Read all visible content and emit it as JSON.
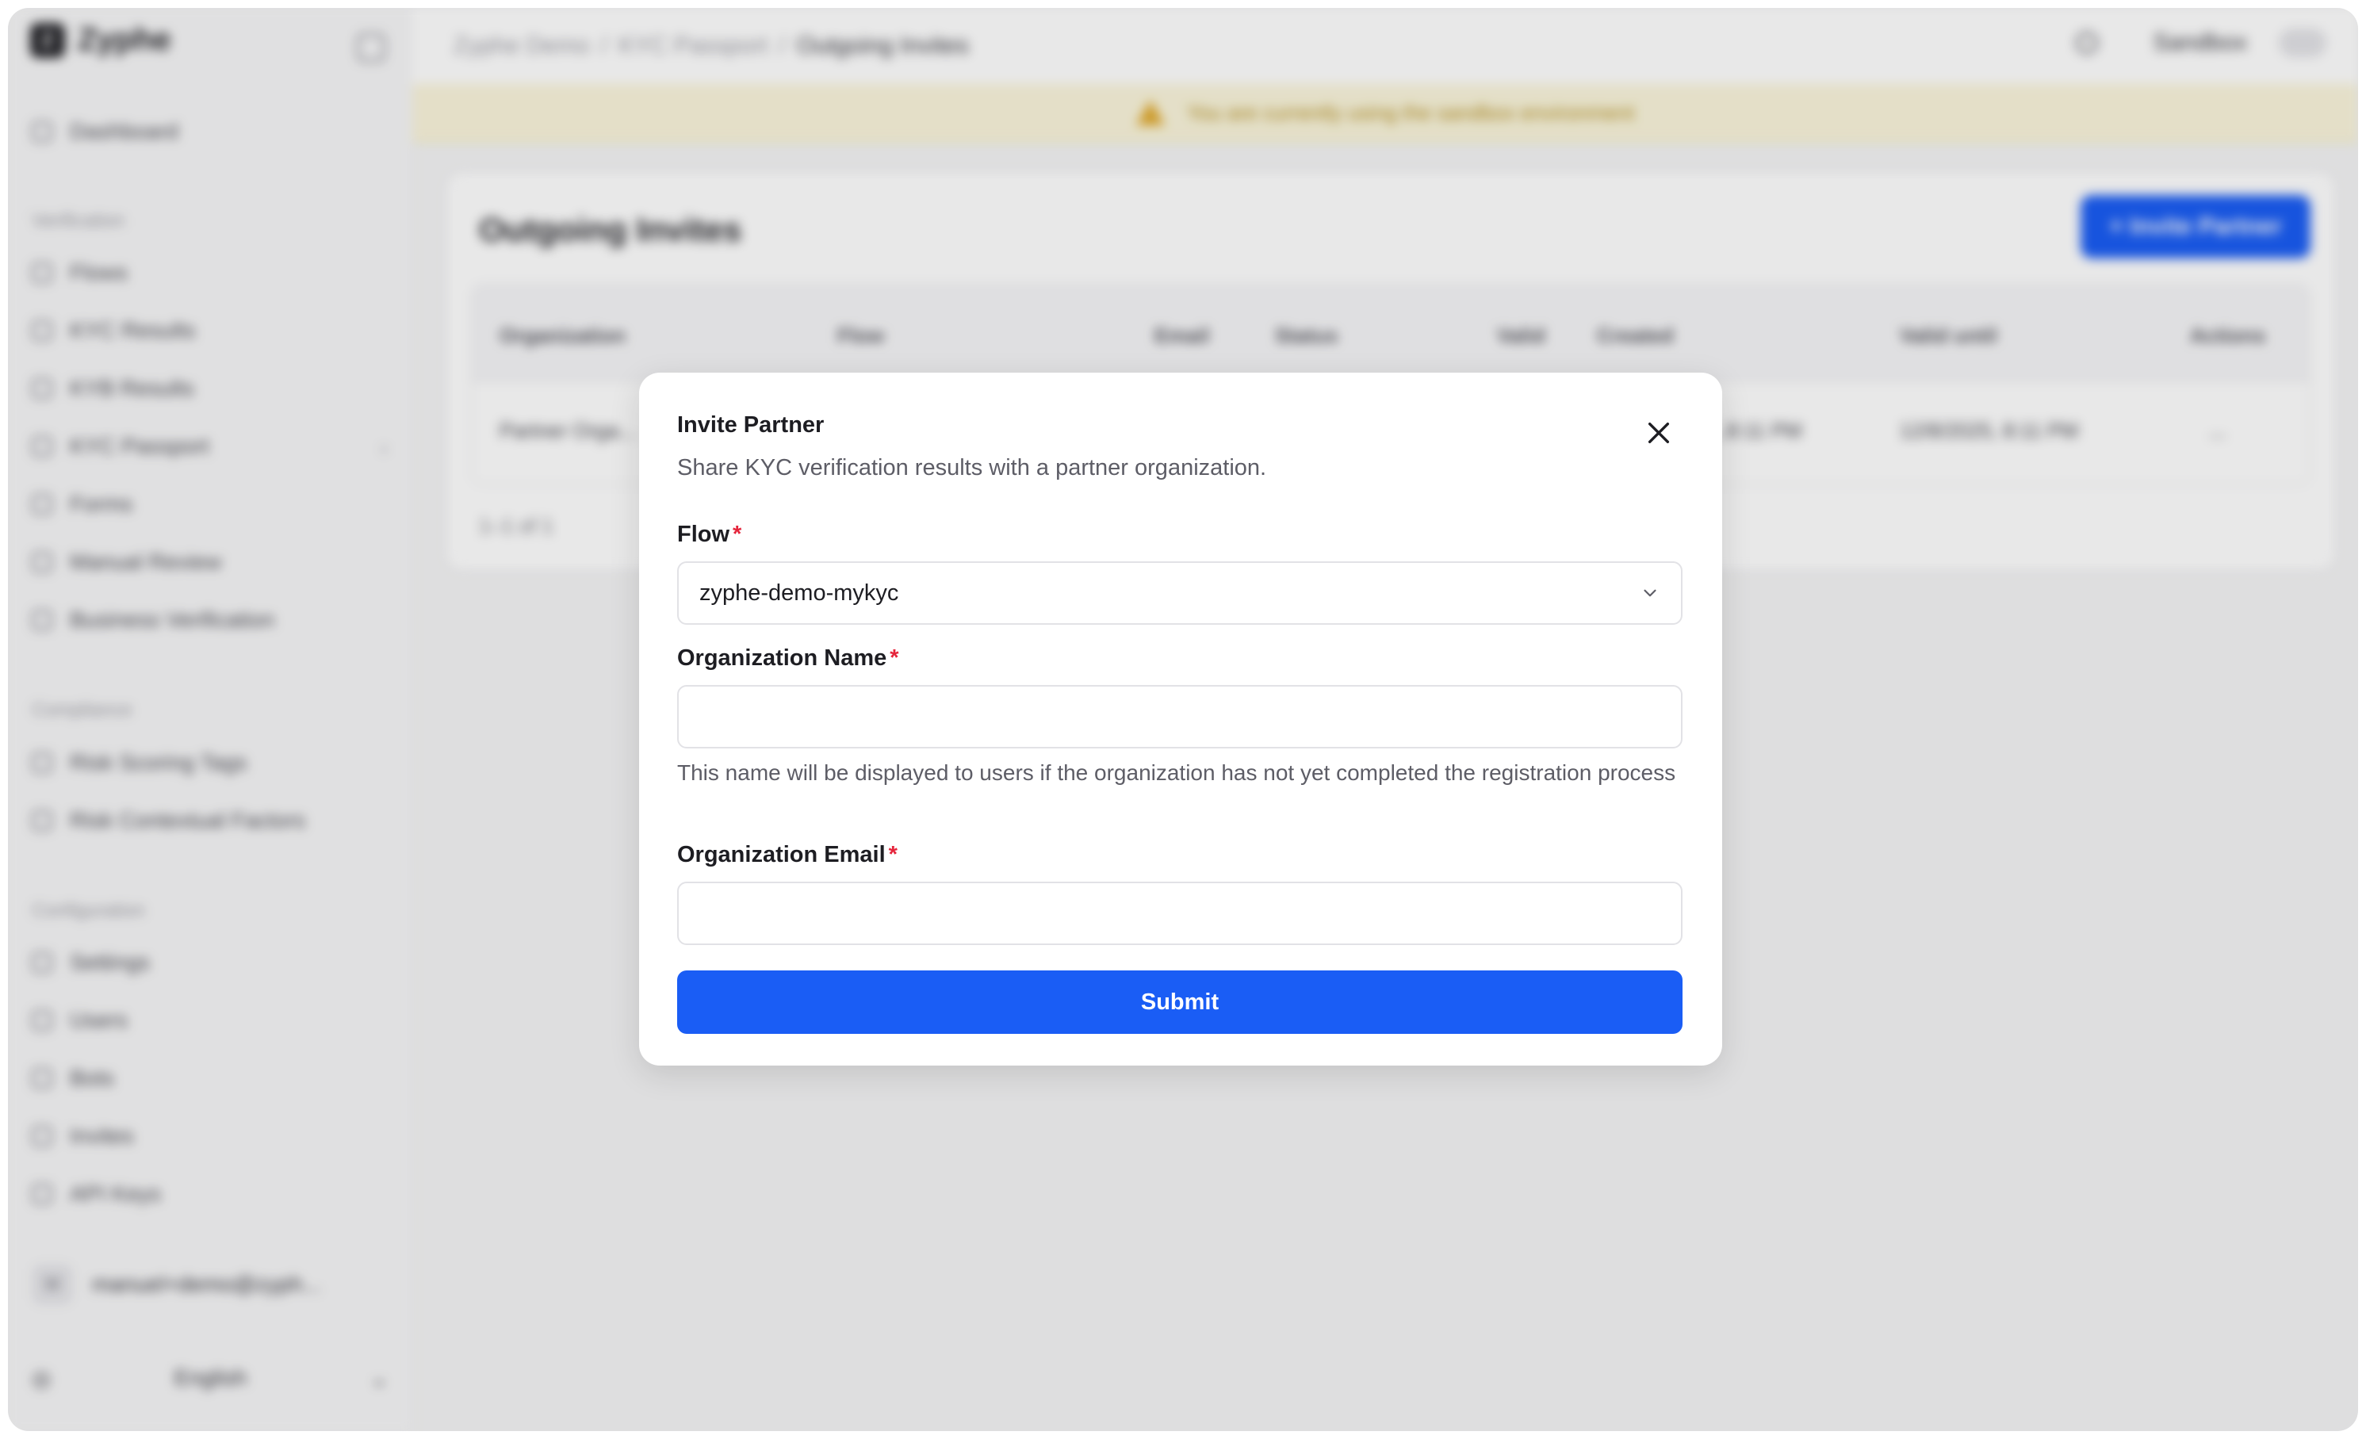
{
  "app": {
    "brand": "Zyphe",
    "brand_initial": "Z"
  },
  "sidebar": {
    "dashboard": "Dashboard",
    "sections": [
      {
        "title": "Verification",
        "items": [
          "Flows",
          "KYC Results",
          "KYB Results",
          "KYC Passport",
          "Forms",
          "Manual Review",
          "Business Verification"
        ]
      },
      {
        "title": "Compliance",
        "items": [
          "Risk Scoring Tags",
          "Risk Contextual Factors"
        ]
      },
      {
        "title": "Configuration",
        "items": [
          "Settings",
          "Users",
          "Bots",
          "Invites",
          "API Keys"
        ]
      }
    ],
    "user_email": "manuel+demo@zyph...",
    "user_initials": "M",
    "language": "English"
  },
  "topbar": {
    "breadcrumb": [
      "Zyphe Demo",
      "KYC Passport",
      "Outgoing Invites"
    ],
    "environment": "Sandbox"
  },
  "banner": {
    "text": "You are currently using the sandbox environment"
  },
  "page": {
    "title": "Outgoing Invites",
    "invite_button": "+ Invite Partner",
    "columns": [
      "Organization",
      "Flow",
      "Email",
      "Status",
      "Valid",
      "Created",
      "Valid until",
      "Actions"
    ],
    "rows": [
      [
        "Partner Orga...",
        "",
        "",
        "",
        "",
        "...8:11 PM",
        "12/8/2025, 8:11 PM",
        "..."
      ]
    ],
    "pager": "1–1 of 1"
  },
  "modal": {
    "title": "Invite Partner",
    "subtitle": "Share KYC verification results with a partner organization.",
    "flow_label": "Flow",
    "flow_value": "zyphe-demo-mykyc",
    "org_name_label": "Organization Name",
    "org_name_value": "",
    "org_name_help": "This name will be displayed to users if the organization has not yet completed the registration process",
    "org_email_label": "Organization Email",
    "org_email_value": "",
    "required_mark": "*",
    "submit_label": "Submit"
  },
  "colors": {
    "primary": "#1a5df5",
    "required": "#e5243b",
    "banner_bg": "#fbf6dc"
  }
}
